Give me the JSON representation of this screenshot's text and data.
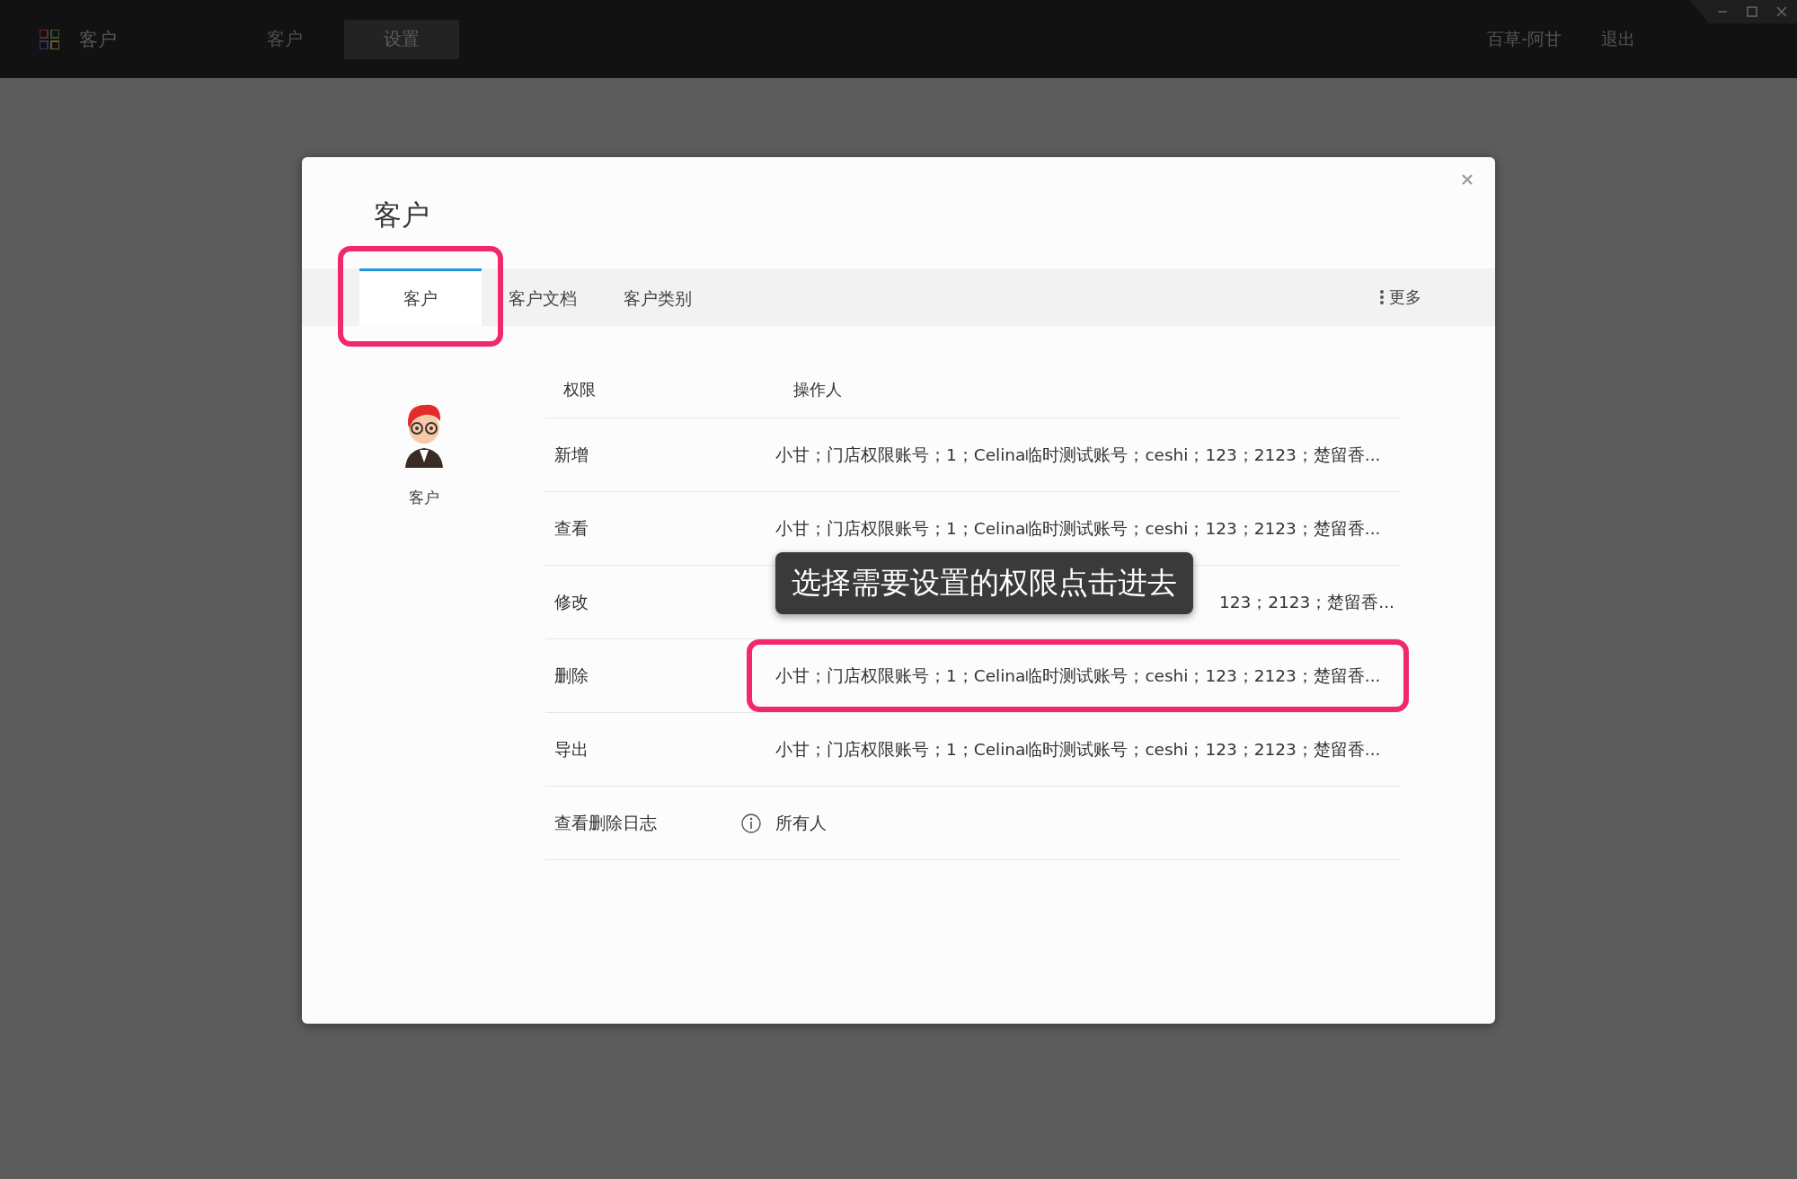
{
  "top_bar": {
    "app_name": "客户",
    "nav": [
      {
        "label": "客户",
        "selected": false
      },
      {
        "label": "设置",
        "selected": true
      }
    ],
    "user": "百草-阿甘",
    "logout": "退出"
  },
  "dialog": {
    "title": "客户",
    "tabs": [
      {
        "label": "客户",
        "selected": true,
        "highlighted": true
      },
      {
        "label": "客户文档",
        "selected": false,
        "highlighted": false
      },
      {
        "label": "客户类别",
        "selected": false,
        "highlighted": false
      }
    ],
    "more": "更多",
    "role": {
      "name": "客户"
    },
    "table": {
      "columns": [
        "权限",
        "操作人"
      ],
      "rows": [
        {
          "permission": "新增",
          "operators": "小甘；门店权限账号；1；Celina临时测试账号；ceshi；123；2123；楚留香...",
          "info": false,
          "highlighted": false
        },
        {
          "permission": "查看",
          "operators": "小甘；门店权限账号；1；Celina临时测试账号；ceshi；123；2123；楚留香...",
          "info": false,
          "highlighted": false
        },
        {
          "permission": "修改",
          "operators": "123；2123；楚留香...",
          "info": false,
          "highlighted": false,
          "covered": true
        },
        {
          "permission": "删除",
          "operators": "小甘；门店权限账号；1；Celina临时测试账号；ceshi；123；2123；楚留香...",
          "info": false,
          "highlighted": true
        },
        {
          "permission": "导出",
          "operators": "小甘；门店权限账号；1；Celina临时测试账号；ceshi；123；2123；楚留香...",
          "info": false,
          "highlighted": false
        },
        {
          "permission": "查看删除日志",
          "operators": "所有人",
          "info": true,
          "highlighted": false
        }
      ]
    },
    "tooltip": "选择需要设置的权限点击进去"
  }
}
